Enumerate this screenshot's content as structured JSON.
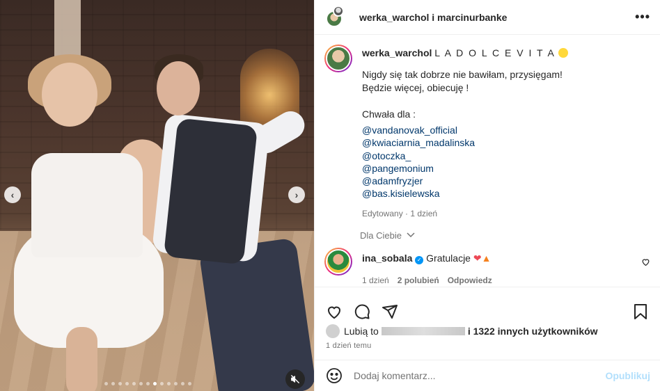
{
  "header": {
    "title": "werka_warchol i marcinurbanke",
    "more_icon": "more-horizontal-icon"
  },
  "caption": {
    "username": "werka_warchol",
    "headline": "L A D O L C E V I T A",
    "headline_emoji": "lemon-emoji",
    "lines": [
      "Nigdy się tak dobrze nie bawiłam, przysięgam!",
      "Będzie więcej, obiecuję !",
      "",
      "Chwała dla :"
    ],
    "mentions": [
      "@vandanovak_official",
      "@kwiaciarnia_madalinska",
      "@otoczka_",
      "@pangemonium",
      "@adamfryzjer",
      "@bas.kisielewska"
    ],
    "edited": "Edytowany · 1 dzień"
  },
  "for_you": "Dla Ciebie",
  "comment": {
    "username": "ina_sobala",
    "text": "Gratulacje",
    "emojis": [
      "red-heart-emoji",
      "fire-emoji"
    ],
    "time": "1 dzień",
    "likes": "2 polubień",
    "reply": "Odpowiedz"
  },
  "likes": {
    "prefix": "Lubią to",
    "suffix": "i 1322 innych użytkowników"
  },
  "post_time": "1 dzień temu",
  "add_comment": {
    "placeholder": "Dodaj komentarz...",
    "publish": "Opublikuj"
  },
  "media": {
    "carousel_count": 13,
    "carousel_active": 8
  },
  "colors": {
    "link": "#00376b",
    "muted": "#737373",
    "publish_disabled": "#b2dffc",
    "verified": "#0095f6"
  }
}
